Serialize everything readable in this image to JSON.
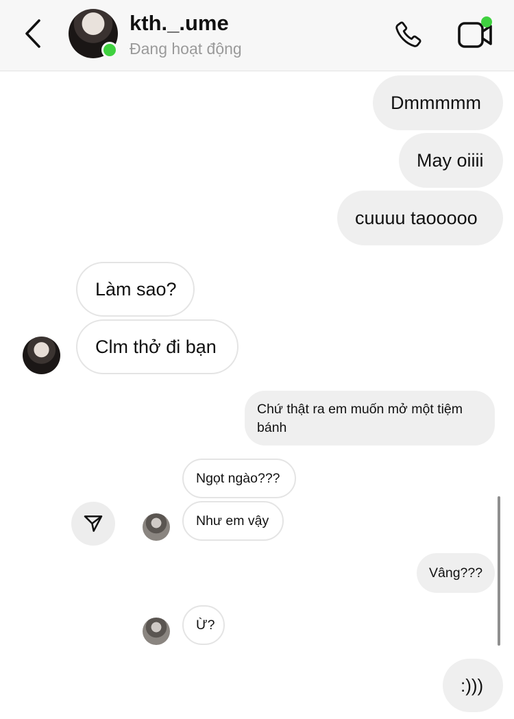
{
  "header": {
    "contact_name": "kth._.ume",
    "status": "Đang hoạt động",
    "online_color": "#3fd13f",
    "icons": [
      "chevron-left-icon",
      "phone-icon",
      "video-camera-icon"
    ]
  },
  "messages": [
    {
      "direction": "outgoing",
      "text": "Dmmmmm"
    },
    {
      "direction": "outgoing",
      "text": "May oiiii"
    },
    {
      "direction": "outgoing",
      "text": "cuuuu taooooo"
    },
    {
      "direction": "incoming",
      "text": "Làm sao?"
    },
    {
      "direction": "incoming",
      "text": "Clm thở đi bạn"
    },
    {
      "direction": "outgoing",
      "text": "Chứ thật ra em muốn mở một tiệm bánh"
    },
    {
      "direction": "incoming",
      "text": "Ngọt ngào???"
    },
    {
      "direction": "incoming",
      "text": "Như em vậy"
    },
    {
      "direction": "outgoing",
      "text": "Vâng???"
    },
    {
      "direction": "incoming",
      "text": "Ừ?"
    },
    {
      "direction": "outgoing",
      "text": ":)))"
    }
  ],
  "share": {
    "icon": "send-icon"
  }
}
